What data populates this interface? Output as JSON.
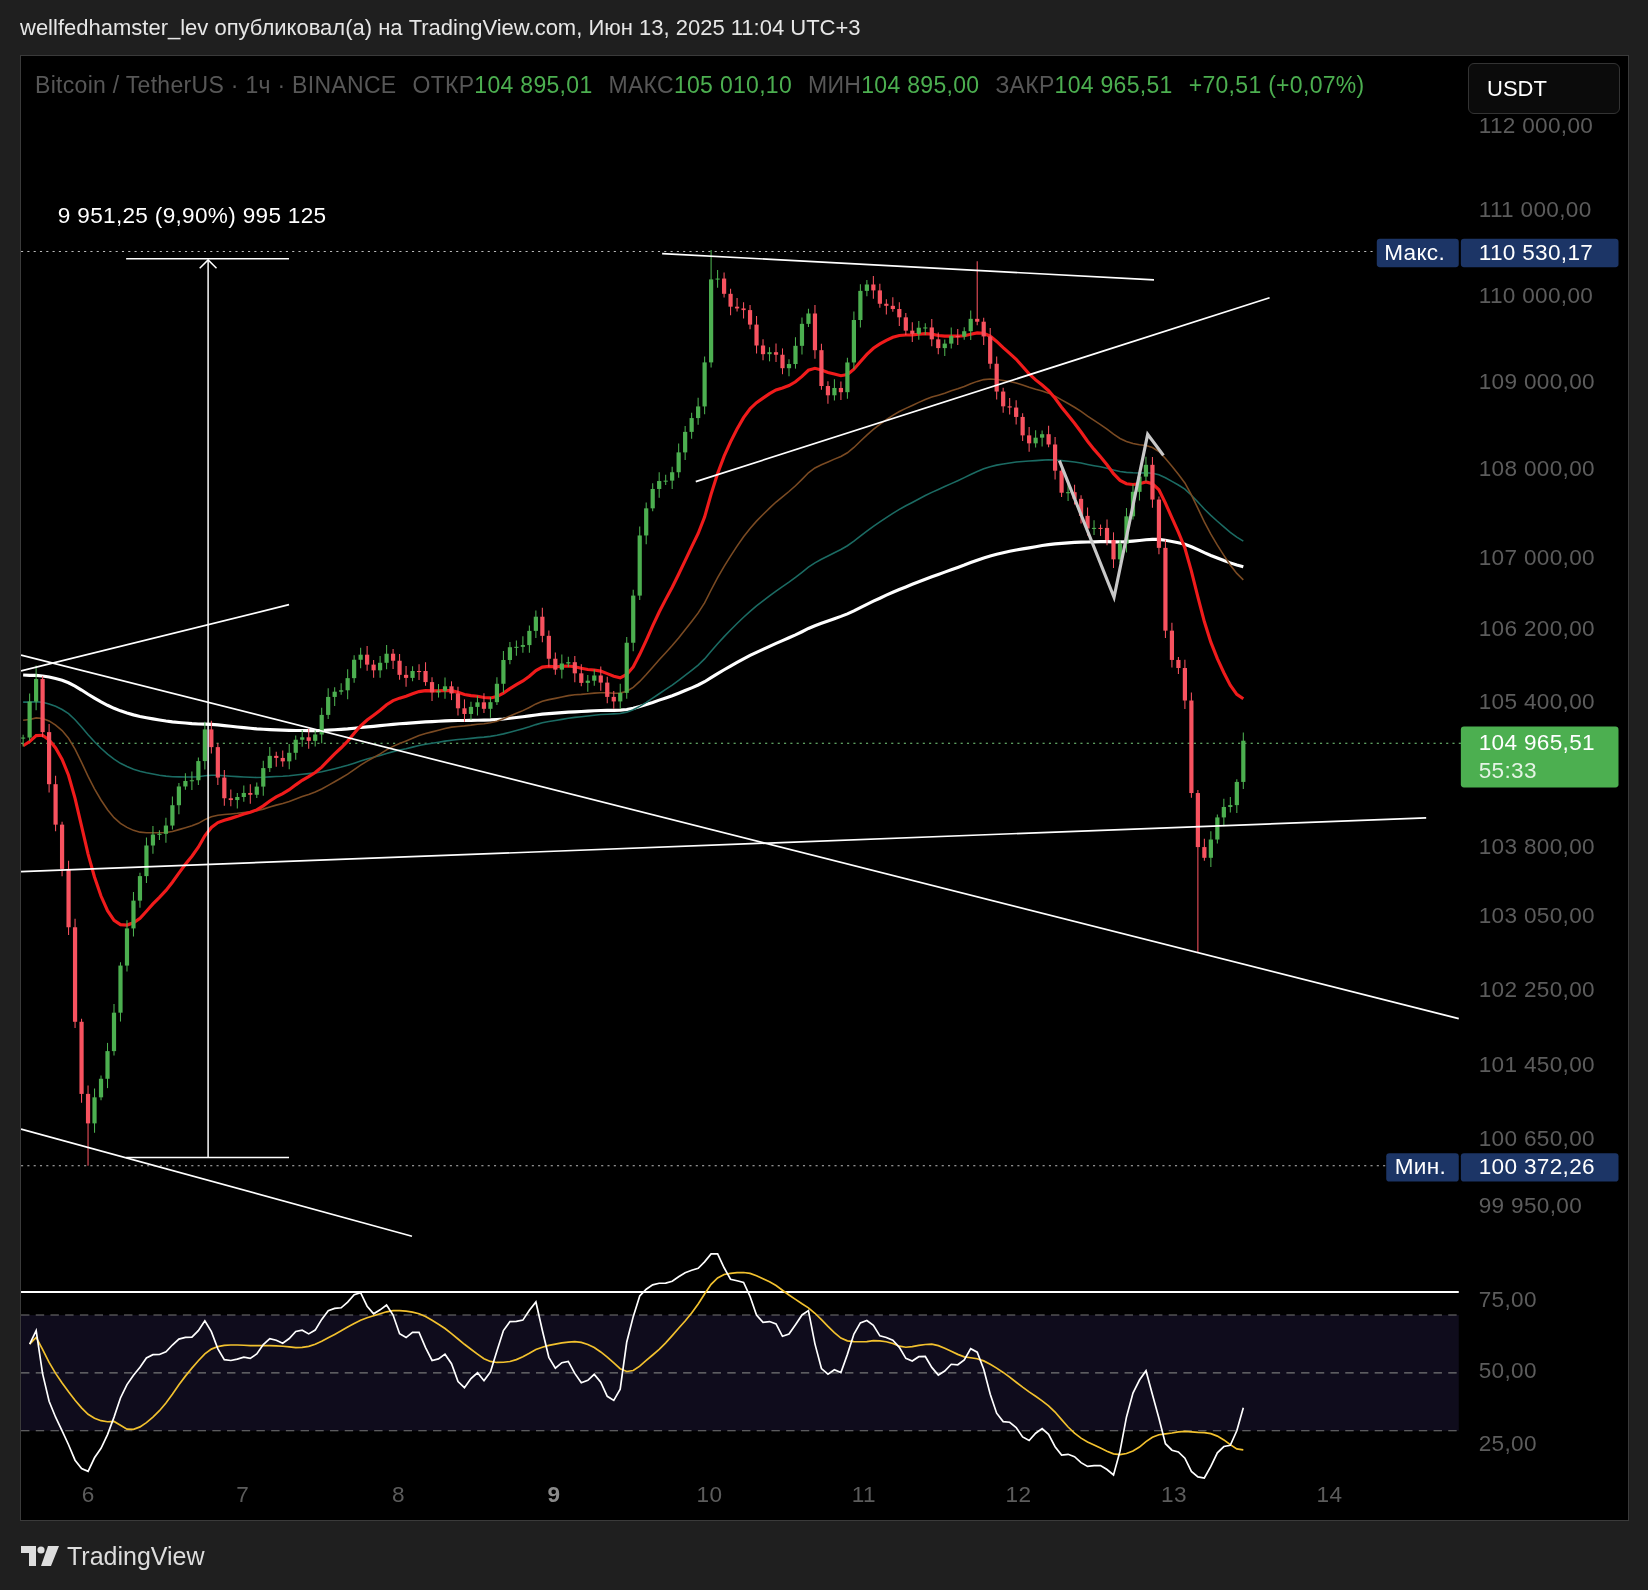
{
  "header": {
    "caption": "wellfedhamster_lev опубликовал(а) на TradingView.com, Июн 13, 2025 11:04 UTC+3"
  },
  "legend": {
    "symbol": "Bitcoin / TetherUS · 1ч · BINANCE",
    "fields": [
      {
        "label": "ОТКР",
        "value": "104 895,01"
      },
      {
        "label": "МАКС",
        "value": "105 010,10"
      },
      {
        "label": "МИН",
        "value": "104 895,00"
      },
      {
        "label": "ЗАКР",
        "value": "104 965,51"
      }
    ],
    "change": "+70,51 (+0,07%)"
  },
  "currency_button": "USDT",
  "measure_label": "9 951,25 (9,90%) 995 125",
  "price_axis": [
    "112 000,00",
    "111 000,00",
    "110 000,00",
    "109 000,00",
    "108 000,00",
    "107 000,00",
    "106 200,00",
    "105 400,00",
    "103 800,00",
    "103 050,00",
    "102 250,00",
    "101 450,00",
    "100 650,00",
    "99 950,00"
  ],
  "price_markers": [
    {
      "kind": "max",
      "label": "Макс.",
      "value": "110 530,17"
    },
    {
      "kind": "min",
      "label": "Мин.",
      "value": "100 372,26"
    }
  ],
  "last_price": {
    "value": "104 965,51",
    "countdown": "55:33"
  },
  "rsi_axis": [
    "75,00",
    "50,00",
    "25,00"
  ],
  "time_axis": [
    {
      "label": "6",
      "emphasized": false
    },
    {
      "label": "7",
      "emphasized": false
    },
    {
      "label": "8",
      "emphasized": false
    },
    {
      "label": "9",
      "emphasized": true
    },
    {
      "label": "10",
      "emphasized": false
    },
    {
      "label": "11",
      "emphasized": false
    },
    {
      "label": "12",
      "emphasized": false
    },
    {
      "label": "13",
      "emphasized": false
    },
    {
      "label": "14",
      "emphasized": false
    }
  ],
  "footer": {
    "brand": "TradingView"
  }
}
